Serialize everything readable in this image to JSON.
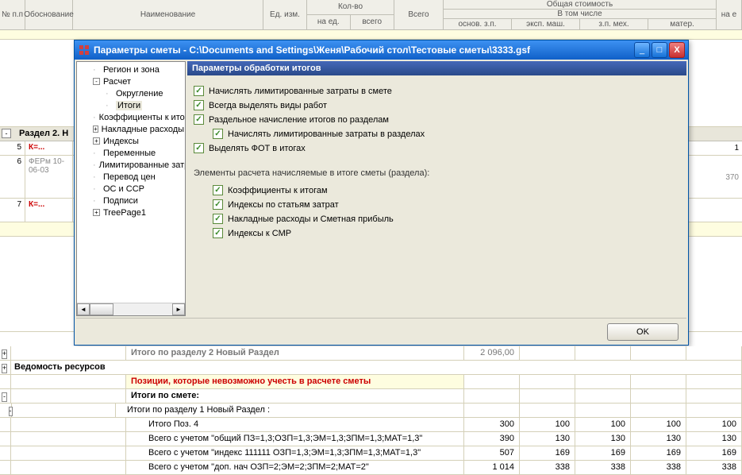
{
  "header_cells": {
    "npp": "№ п.п",
    "obosnov": "Обоснование",
    "naimen": "Наименование",
    "ed_izm": "Ед. изм.",
    "kolvo": "Кол-во",
    "na_ed": "на ед.",
    "vsego1": "всего",
    "vsego2": "Всего",
    "obsh_stoim": "Общая стоимость",
    "v_tom_chisle": "В том числе",
    "osnov_zp": "основ. з.п.",
    "eksp_mash": "эксп. маш.",
    "zp_meh": "з.п. мех.",
    "mater": "матер.",
    "na_e2": "на е"
  },
  "dialog": {
    "title": "Параметры сметы - C:\\Documents and Settings\\Женя\\Рабочий стол\\Тестовые сметы\\3333.gsf",
    "panel_title": "Параметры обработки итогов",
    "elements_label": "Элементы расчета начисляемые в итоге сметы (раздела):",
    "ok": "OK"
  },
  "tree": [
    {
      "label": "Регион и зона",
      "lvl": 1,
      "exp": ""
    },
    {
      "label": "Расчет",
      "lvl": 1,
      "exp": "-"
    },
    {
      "label": "Округление",
      "lvl": 2,
      "exp": ""
    },
    {
      "label": "Итоги",
      "lvl": 2,
      "exp": "",
      "sel": true
    },
    {
      "label": "Коэффициенты к итогам",
      "lvl": 1,
      "exp": ""
    },
    {
      "label": "Накладные расходы",
      "lvl": 1,
      "exp": "+"
    },
    {
      "label": "Индексы",
      "lvl": 1,
      "exp": "+"
    },
    {
      "label": "Переменные",
      "lvl": 1,
      "exp": ""
    },
    {
      "label": "Лимитированные затраты",
      "lvl": 1,
      "exp": ""
    },
    {
      "label": "Перевод цен",
      "lvl": 1,
      "exp": ""
    },
    {
      "label": "ОС и ССР",
      "lvl": 1,
      "exp": ""
    },
    {
      "label": "Подписи",
      "lvl": 1,
      "exp": ""
    },
    {
      "label": "TreePage1",
      "lvl": 1,
      "exp": "+"
    }
  ],
  "checks": [
    {
      "label": "Начислять лимитированные затраты в смете"
    },
    {
      "label": "Всегда выделять виды работ"
    },
    {
      "label": "Раздельное начисление итогов по разделам"
    },
    {
      "label": "Начислять лимитированные затраты в разделах",
      "indent": true
    },
    {
      "label": "Выделять ФОТ в итогах"
    }
  ],
  "checks2": [
    {
      "label": "Коэффициенты к итогам"
    },
    {
      "label": "Индексы по статьям затрат"
    },
    {
      "label": "Накладные расходы и Сметная прибыль"
    },
    {
      "label": "Индексы к СМР"
    }
  ],
  "bg": {
    "section2": "Раздел 2. Н",
    "row5_code": "К=...",
    "row6_code": "ФЕРм 10-06-03",
    "row6_v": "370",
    "row5_v": "1",
    "row7_code": "К=..."
  },
  "bottom": {
    "itogo_razdel2": "Итого по разделу 2 Новый Раздел",
    "itogo_razdel2_val": "2 096,00",
    "vedomost": "Ведомость ресурсов",
    "pozicii": "Позиции, которые невозможно учесть в расчете сметы",
    "itogi_smete": "Итоги по смете:",
    "itogi_razdel1": "Итоги по разделу 1 Новый Раздел :",
    "rows": [
      {
        "name": "Итого Поз. 4",
        "v": [
          "300",
          "100",
          "100",
          "100",
          "100"
        ]
      },
      {
        "name": "Всего с учетом \"общий ПЗ=1,3;ОЗП=1,3;ЭМ=1,3;ЗПМ=1,3;МАТ=1,3\"",
        "v": [
          "390",
          "130",
          "130",
          "130",
          "130"
        ]
      },
      {
        "name": "Всего с учетом \"индекс 111111 ОЗП=1,3;ЭМ=1,3;ЗПМ=1,3;МАТ=1,3\"",
        "v": [
          "507",
          "169",
          "169",
          "169",
          "169"
        ]
      },
      {
        "name": "Всего с учетом \"доп. нач ОЗП=2;ЭМ=2;ЗПМ=2;МАТ=2\"",
        "v": [
          "1 014",
          "338",
          "338",
          "338",
          "338"
        ]
      }
    ]
  }
}
